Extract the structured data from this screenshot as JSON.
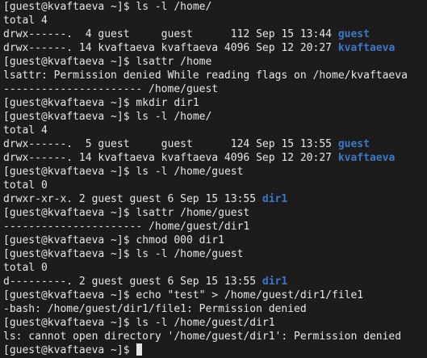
{
  "colors": {
    "background": "#1c1c1c",
    "text": "#e6e6e6",
    "directory": "#3d77c8"
  },
  "terminal": {
    "prompt": "[guest@kvaftaeva ~]$ ",
    "lines": [
      {
        "type": "cmd",
        "text": "ls -l /home/"
      },
      {
        "type": "out",
        "text": "total 4"
      },
      {
        "type": "ls",
        "text": "drwx------.  4 guest     guest      112 Sep 15 13:44 ",
        "dir": "guest"
      },
      {
        "type": "ls",
        "text": "drwx------. 14 kvaftaeva kvaftaeva 4096 Sep 12 20:27 ",
        "dir": "kvaftaeva"
      },
      {
        "type": "cmd",
        "text": "lsattr /home"
      },
      {
        "type": "out",
        "text": "lsattr: Permission denied While reading flags on /home/kvaftaeva"
      },
      {
        "type": "out",
        "text": "---------------------- /home/guest"
      },
      {
        "type": "cmd",
        "text": "mkdir dir1"
      },
      {
        "type": "cmd",
        "text": "ls -l /home/"
      },
      {
        "type": "out",
        "text": "total 4"
      },
      {
        "type": "ls",
        "text": "drwx------.  5 guest     guest      124 Sep 15 13:55 ",
        "dir": "guest"
      },
      {
        "type": "ls",
        "text": "drwx------. 14 kvaftaeva kvaftaeva 4096 Sep 12 20:27 ",
        "dir": "kvaftaeva"
      },
      {
        "type": "cmd",
        "text": "ls -l /home/guest"
      },
      {
        "type": "out",
        "text": "total 0"
      },
      {
        "type": "ls",
        "text": "drwxr-xr-x. 2 guest guest 6 Sep 15 13:55 ",
        "dir": "dir1"
      },
      {
        "type": "cmd",
        "text": "lsattr /home/guest"
      },
      {
        "type": "out",
        "text": "---------------------- /home/guest/dir1"
      },
      {
        "type": "cmd",
        "text": "chmod 000 dir1"
      },
      {
        "type": "cmd",
        "text": "ls -l /home/guest"
      },
      {
        "type": "out",
        "text": "total 0"
      },
      {
        "type": "ls",
        "text": "d---------. 2 guest guest 6 Sep 15 13:55 ",
        "dir": "dir1"
      },
      {
        "type": "cmd",
        "text": "echo \"test\" > /home/guest/dir1/file1"
      },
      {
        "type": "out",
        "text": "-bash: /home/guest/dir1/file1: Permission denied"
      },
      {
        "type": "cmd",
        "text": "ls -l /home/guest/dir1"
      },
      {
        "type": "out",
        "text": "ls: cannot open directory '/home/guest/dir1': Permission denied"
      },
      {
        "type": "prompt",
        "text": ""
      }
    ]
  }
}
